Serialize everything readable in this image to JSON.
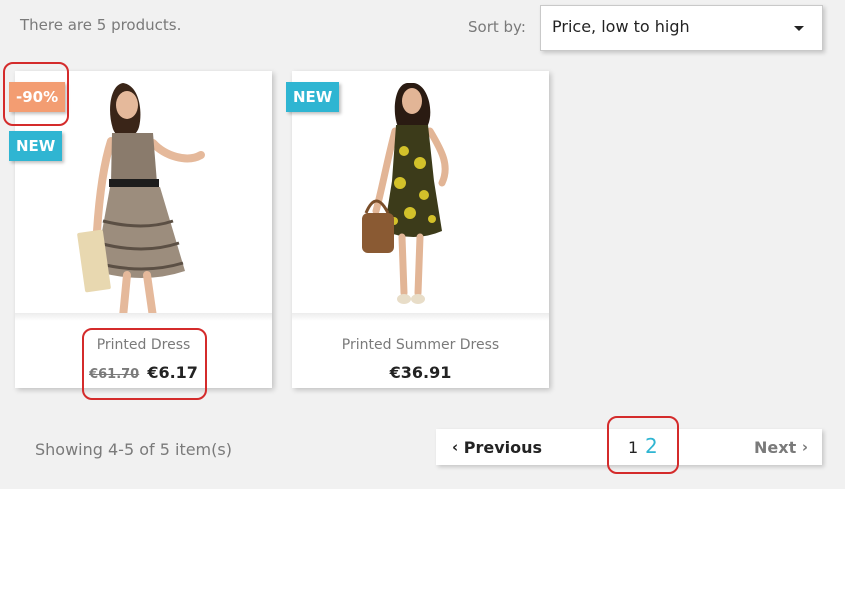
{
  "listing": {
    "products_count": "There are 5 products.",
    "sort": {
      "label": "Sort by:",
      "value": "Price, low to high",
      "caret_icon": "caret-down-icon"
    }
  },
  "products": [
    {
      "name": "Printed Dress",
      "old_price": "€61.70",
      "price": "€6.17",
      "flags": [
        "-90%",
        "NEW"
      ]
    },
    {
      "name": "Printed Summer Dress",
      "price": "€36.91",
      "flags": [
        "NEW"
      ]
    }
  ],
  "pagination": {
    "showing": "Showing 4-5 of 5 item(s)",
    "previous_label": "Previous",
    "next_label": "Next",
    "prev_icon": "chevron-left-icon",
    "next_icon": "chevron-right-icon",
    "pages": [
      "1",
      "2"
    ]
  },
  "colors": {
    "accent": "#2fb5d2",
    "discount": "#f39d72",
    "highlight": "#d42b2b",
    "background": "#f1f1f1"
  }
}
